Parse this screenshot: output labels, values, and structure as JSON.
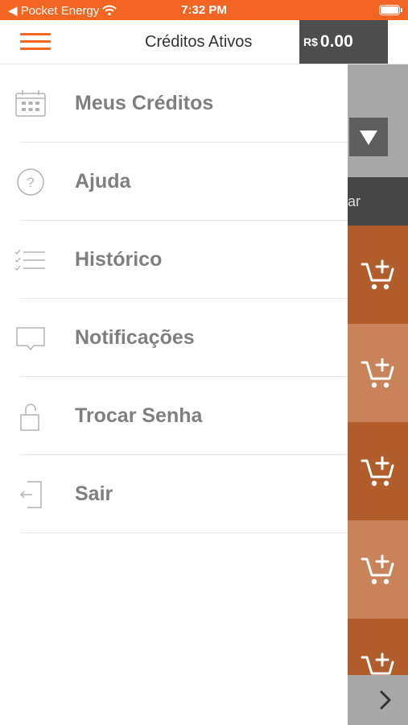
{
  "status_bar": {
    "back_label": "◀ Pocket Energy",
    "time": "7:32 PM"
  },
  "header": {
    "title": "Créditos Ativos",
    "currency": "R$",
    "balance": "0.00"
  },
  "menu": {
    "items": [
      {
        "label": "Meus Créditos",
        "icon": "calendar-icon"
      },
      {
        "label": "Ajuda",
        "icon": "help-icon"
      },
      {
        "label": "Histórico",
        "icon": "checklist-icon"
      },
      {
        "label": "Notificações",
        "icon": "message-icon"
      },
      {
        "label": "Trocar Senha",
        "icon": "unlock-icon"
      },
      {
        "label": "Sair",
        "icon": "logout-icon"
      }
    ]
  },
  "background": {
    "partial_text": "ar"
  },
  "colors": {
    "accent": "#f26522",
    "menu_text": "#7f7f7f",
    "balance_bg": "#4d4d4d"
  }
}
